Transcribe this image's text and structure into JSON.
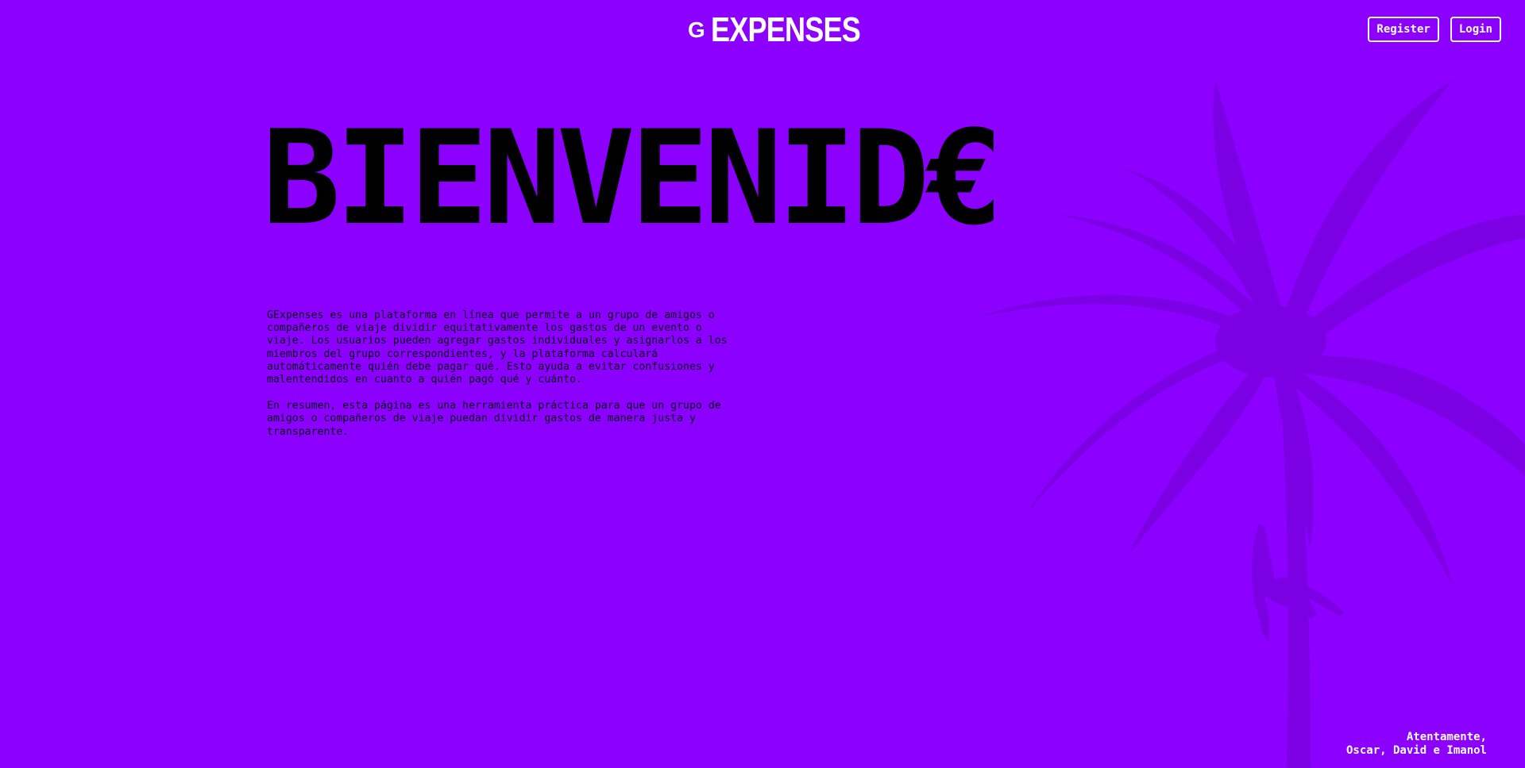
{
  "header": {
    "logo_prefix": "G",
    "logo_word": "EXPENSES",
    "register_label": "Register",
    "login_label": "Login"
  },
  "hero": {
    "title": "BIENVENID€"
  },
  "intro": {
    "paragraphs": [
      "GExpenses es una plataforma en línea que permite a un grupo de amigos o compañeros de viaje dividir equitativamente los gastos de un evento o viaje. Los usuarios pueden agregar gastos individuales y asignarlos a los miembros del grupo correspondientes, y la plataforma calculará automáticamente quién debe pagar qué. Esto ayuda a evitar confusiones y malentendidos en cuanto a quién pagó qué y cuánto.",
      "En resumen, esta página es una herramienta práctica para que un grupo de amigos o compañeros de viaje puedan dividir gastos de manera justa y transparente."
    ]
  },
  "signature": {
    "line1": "Atentamente,",
    "line2": "Oscar, David e Imanol"
  },
  "colors": {
    "background": "#8B00FF",
    "palm_silhouette": "#7A00E0",
    "text": "#000000",
    "accent": "#FFFFFF"
  },
  "icons": {
    "background_image": "palm-tree-with-climber-silhouette"
  }
}
